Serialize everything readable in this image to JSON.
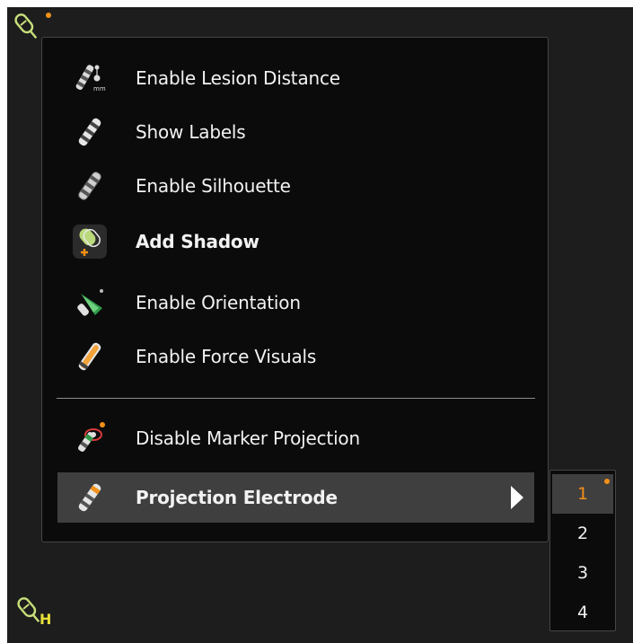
{
  "context_menu": {
    "items": [
      {
        "label": "Enable Lesion Distance",
        "icon": "lesion-distance-icon"
      },
      {
        "label": "Show Labels",
        "icon": "labels-icon"
      },
      {
        "label": "Enable Silhouette",
        "icon": "silhouette-icon"
      },
      {
        "label": "Add Shadow",
        "icon": "add-shadow-icon"
      },
      {
        "label": "Enable Orientation",
        "icon": "orientation-icon"
      },
      {
        "label": "Enable Force Visuals",
        "icon": "force-visuals-icon"
      },
      {
        "label": "Disable Marker Projection",
        "icon": "marker-projection-icon"
      },
      {
        "label": "Projection Electrode",
        "icon": "projection-electrode-icon",
        "has_submenu": true,
        "highlighted": true
      }
    ]
  },
  "submenu": {
    "items": [
      "1",
      "2",
      "3",
      "4"
    ],
    "selected": "1"
  },
  "canvas": {
    "bottom_badge_letter": "H"
  },
  "colors": {
    "accent": "#f29018",
    "catheter_green": "#c8e07a",
    "highlight": "#3f3f3f",
    "background": "#1d1d1d",
    "menu_bg": "#0b0b0b"
  }
}
